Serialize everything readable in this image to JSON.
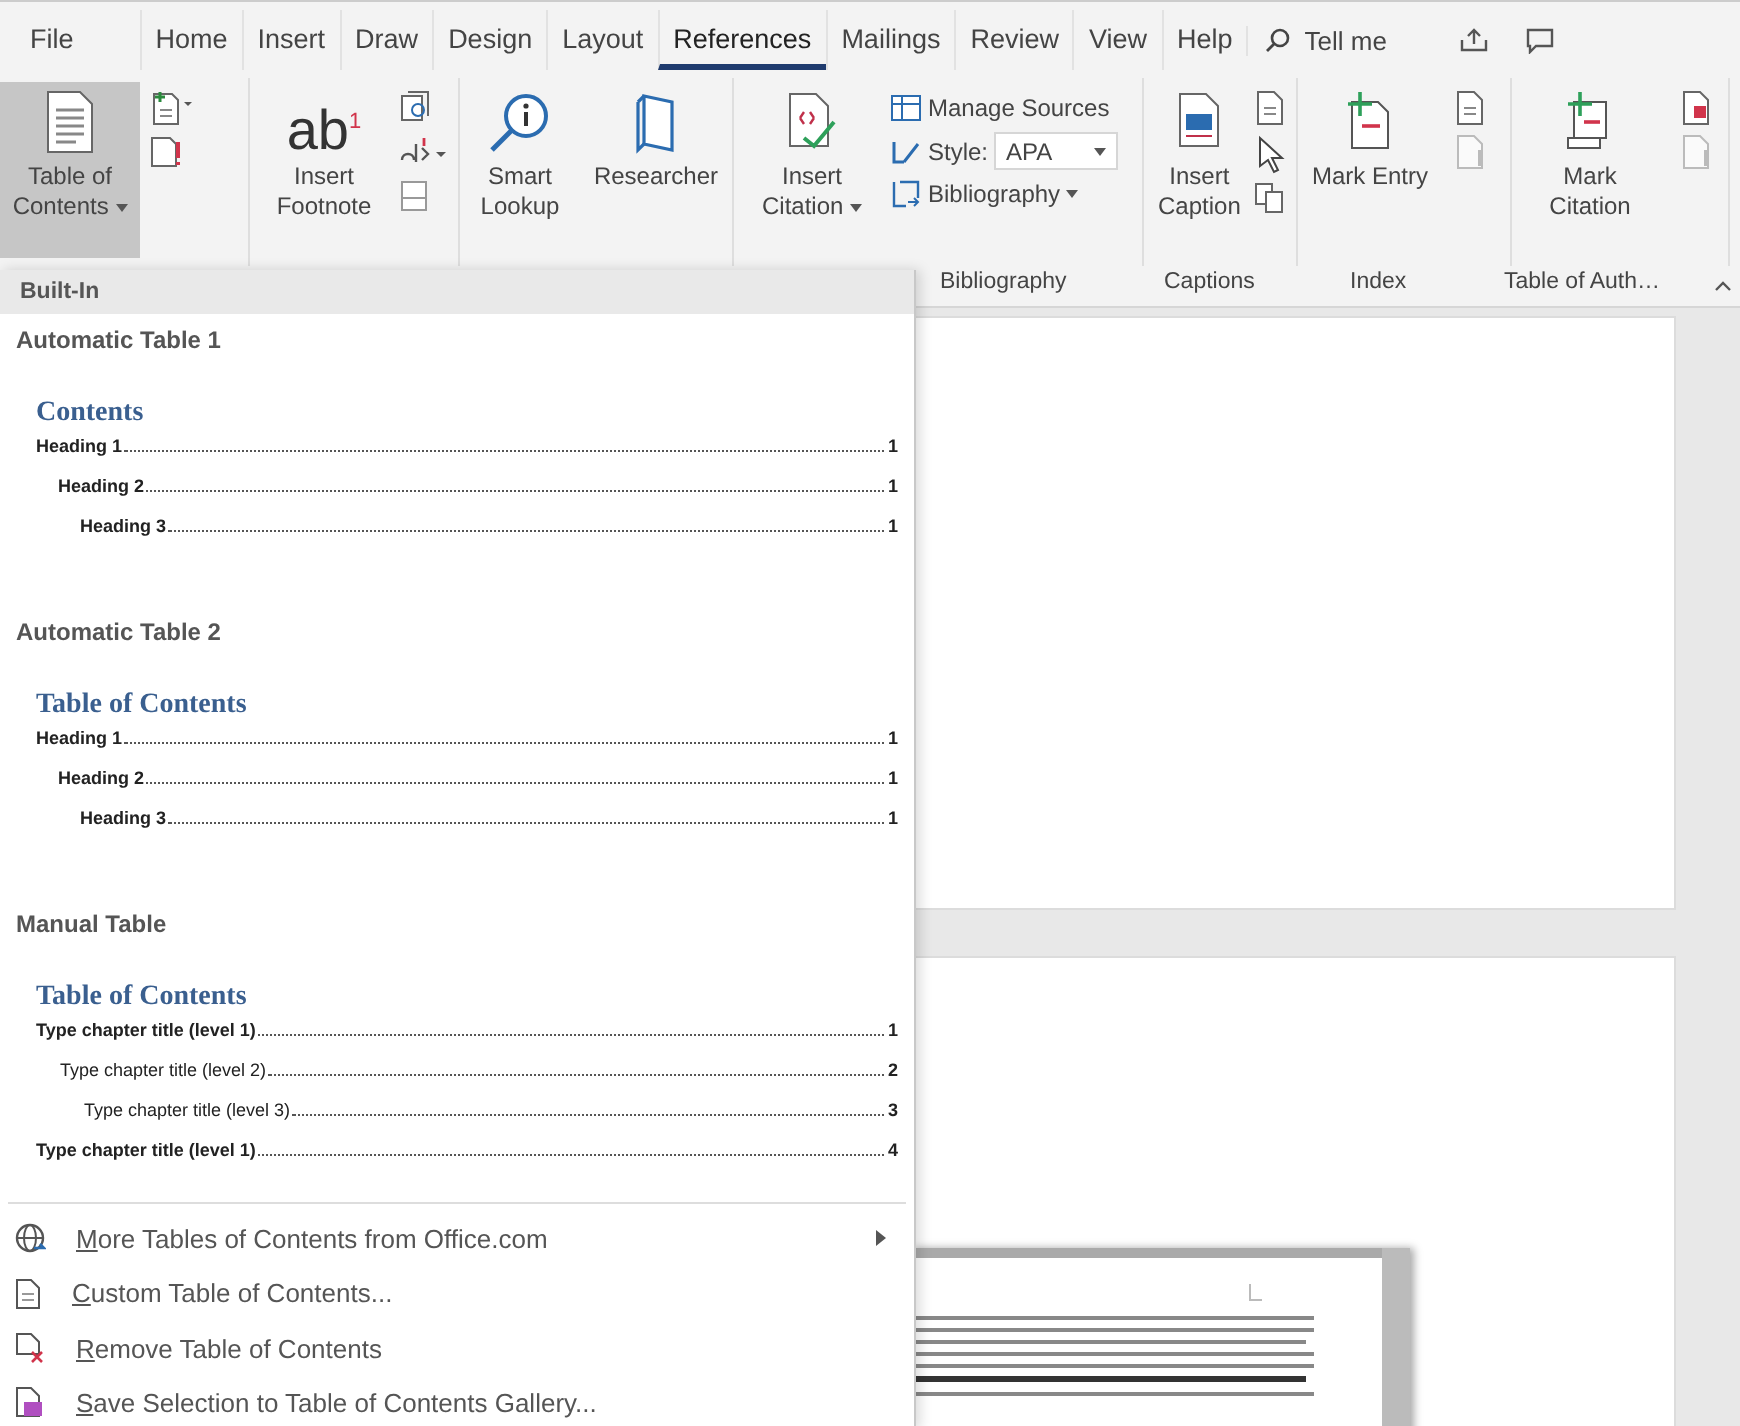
{
  "tabs": [
    {
      "label": "File",
      "selected": false
    },
    {
      "label": "Home",
      "selected": false
    },
    {
      "label": "Insert",
      "selected": false
    },
    {
      "label": "Draw",
      "selected": false
    },
    {
      "label": "Design",
      "selected": false
    },
    {
      "label": "Layout",
      "selected": false
    },
    {
      "label": "References",
      "selected": true
    },
    {
      "label": "Mailings",
      "selected": false
    },
    {
      "label": "Review",
      "selected": false
    },
    {
      "label": "View",
      "selected": false
    },
    {
      "label": "Help",
      "selected": false
    }
  ],
  "tell_me": "Tell me",
  "ribbon": {
    "toc_button": {
      "label": "Table of Contents",
      "pressed": true
    },
    "footnote_button": {
      "icon_text": "ab$^{1}$",
      "label": "Insert Footnote"
    },
    "smart_lookup": "Smart Lookup",
    "researcher": "Researcher",
    "citation_button": "Insert Citation",
    "manage_sources": "Manage Sources",
    "style_label": "Style:",
    "style_value": "APA",
    "bibliography": "Bibliography",
    "caption_button": "Insert Caption",
    "mark_entry": "Mark Entry",
    "mark_citation": "Mark Citation",
    "group_labels": [
      "Bibliography",
      "Captions",
      "Index",
      "Table of Auth…"
    ]
  },
  "gallery": {
    "header": "Built-In",
    "sections": [
      {
        "title": "Automatic Table 1",
        "heading": "Contents",
        "entries": [
          {
            "text": "Heading 1",
            "page": "1",
            "children": [
              {
                "text": "Heading 2",
                "page": "1",
                "children": [
                  {
                    "text": "Heading 3",
                    "page": "1"
                  }
                ]
              }
            ]
          }
        ]
      },
      {
        "title": "Automatic Table 2",
        "heading": "Table of Contents",
        "entries": [
          {
            "text": "Heading 1",
            "page": "1",
            "children": [
              {
                "text": "Heading 2",
                "page": "1",
                "children": [
                  {
                    "text": "Heading 3",
                    "page": "1"
                  }
                ]
              }
            ]
          }
        ]
      },
      {
        "title": "Manual Table",
        "heading": "Table of Contents",
        "entries": [
          {
            "text": "Type chapter title (level 1)",
            "page": "1",
            "children": [
              {
                "text": "Type chapter title (level 2)",
                "page": "2",
                "children": [
                  {
                    "text": "Type chapter title (level 3)",
                    "page": "3"
                  }
                ]
              }
            ]
          },
          {
            "text": "Type chapter title (level 1)",
            "page": "4"
          }
        ]
      }
    ]
  },
  "menu": [
    {
      "label": "More Tables of Contents from Office.com",
      "access_key_underlined": true,
      "submenu": true
    },
    {
      "label": "Custom Table of Contents...",
      "access_key_underlined": true,
      "submenu": false
    },
    {
      "label": "Remove Table of Contents",
      "access_key_underlined": true,
      "submenu": false
    },
    {
      "label": "Save Selection to Table of Contents Gallery...",
      "access_key_underlined": true,
      "submenu": false
    }
  ]
}
